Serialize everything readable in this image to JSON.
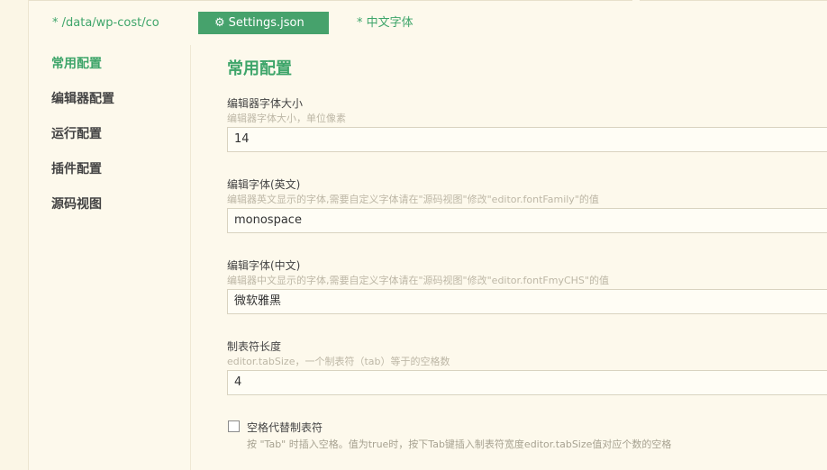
{
  "tabs": [
    {
      "label": "* /data/wp-cost/co"
    },
    {
      "label": "Settings.json",
      "icon": "gear-icon"
    },
    {
      "label": "* 中文字体"
    }
  ],
  "sidebar": {
    "items": [
      {
        "label": "常用配置"
      },
      {
        "label": "编辑器配置"
      },
      {
        "label": "运行配置"
      },
      {
        "label": "插件配置"
      },
      {
        "label": "源码视图"
      }
    ]
  },
  "main": {
    "title": "常用配置",
    "fields": [
      {
        "label": "编辑器字体大小",
        "desc": "编辑器字体大小，单位像素",
        "value": "14"
      },
      {
        "label": "编辑字体(英文)",
        "desc": "编辑器英文显示的字体,需要自定义字体请在\"源码视图\"修改\"editor.fontFamily\"的值",
        "value": "monospace"
      },
      {
        "label": "编辑字体(中文)",
        "desc": "编辑器中文显示的字体,需要自定义字体请在\"源码视图\"修改\"editor.fontFmyCHS\"的值",
        "value": "微软雅黑"
      },
      {
        "label": "制表符长度",
        "desc": "editor.tabSize，一个制表符（tab）等于的空格数",
        "value": "4"
      }
    ],
    "checkbox": {
      "label": "空格代替制表符",
      "desc": "按 \"Tab\" 时插入空格。值为true时，按下Tab键插入制表符宽度editor.tabSize值对应个数的空格",
      "checked": false
    }
  },
  "colors": {
    "accent": "#3ea56a",
    "tab_active_bg": "#46a26c",
    "background": "#fdf9ec"
  }
}
